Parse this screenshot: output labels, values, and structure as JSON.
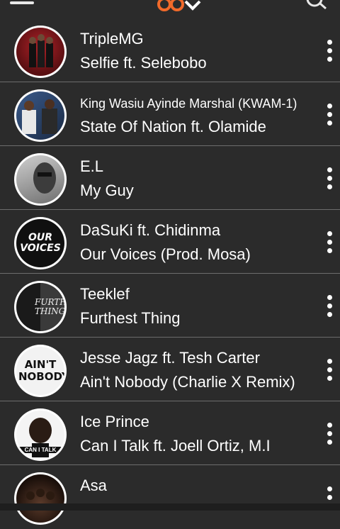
{
  "songs": [
    {
      "artist": "TripleMG",
      "title": "Selfie ft. Selebobo"
    },
    {
      "artist": "King Wasiu Ayinde Marshal (KWAM-1)",
      "title": "State Of Nation ft. Olamide"
    },
    {
      "artist": "E.L",
      "title": "My Guy"
    },
    {
      "artist": "DaSuKi ft. Chidinma",
      "title": "Our Voices (Prod. Mosa)",
      "art_text": "OUR VOICES"
    },
    {
      "artist": "Teeklef",
      "title": "Furthest Thing",
      "art_text": "FURTHEST THING"
    },
    {
      "artist": "Jesse Jagz ft. Tesh Carter",
      "title": "Ain't Nobody (Charlie X Remix)",
      "art_text": "AIN'T NOBODY"
    },
    {
      "artist": "Ice Prince",
      "title": "Can I Talk ft. Joell Ortiz, M.I",
      "art_text": "CAN I TALK"
    },
    {
      "artist": "Asa",
      "title": ""
    }
  ],
  "colors": {
    "background": "#2b2b2b",
    "divider": "#6d6d6d",
    "logo_accent": "#f26a2a"
  }
}
